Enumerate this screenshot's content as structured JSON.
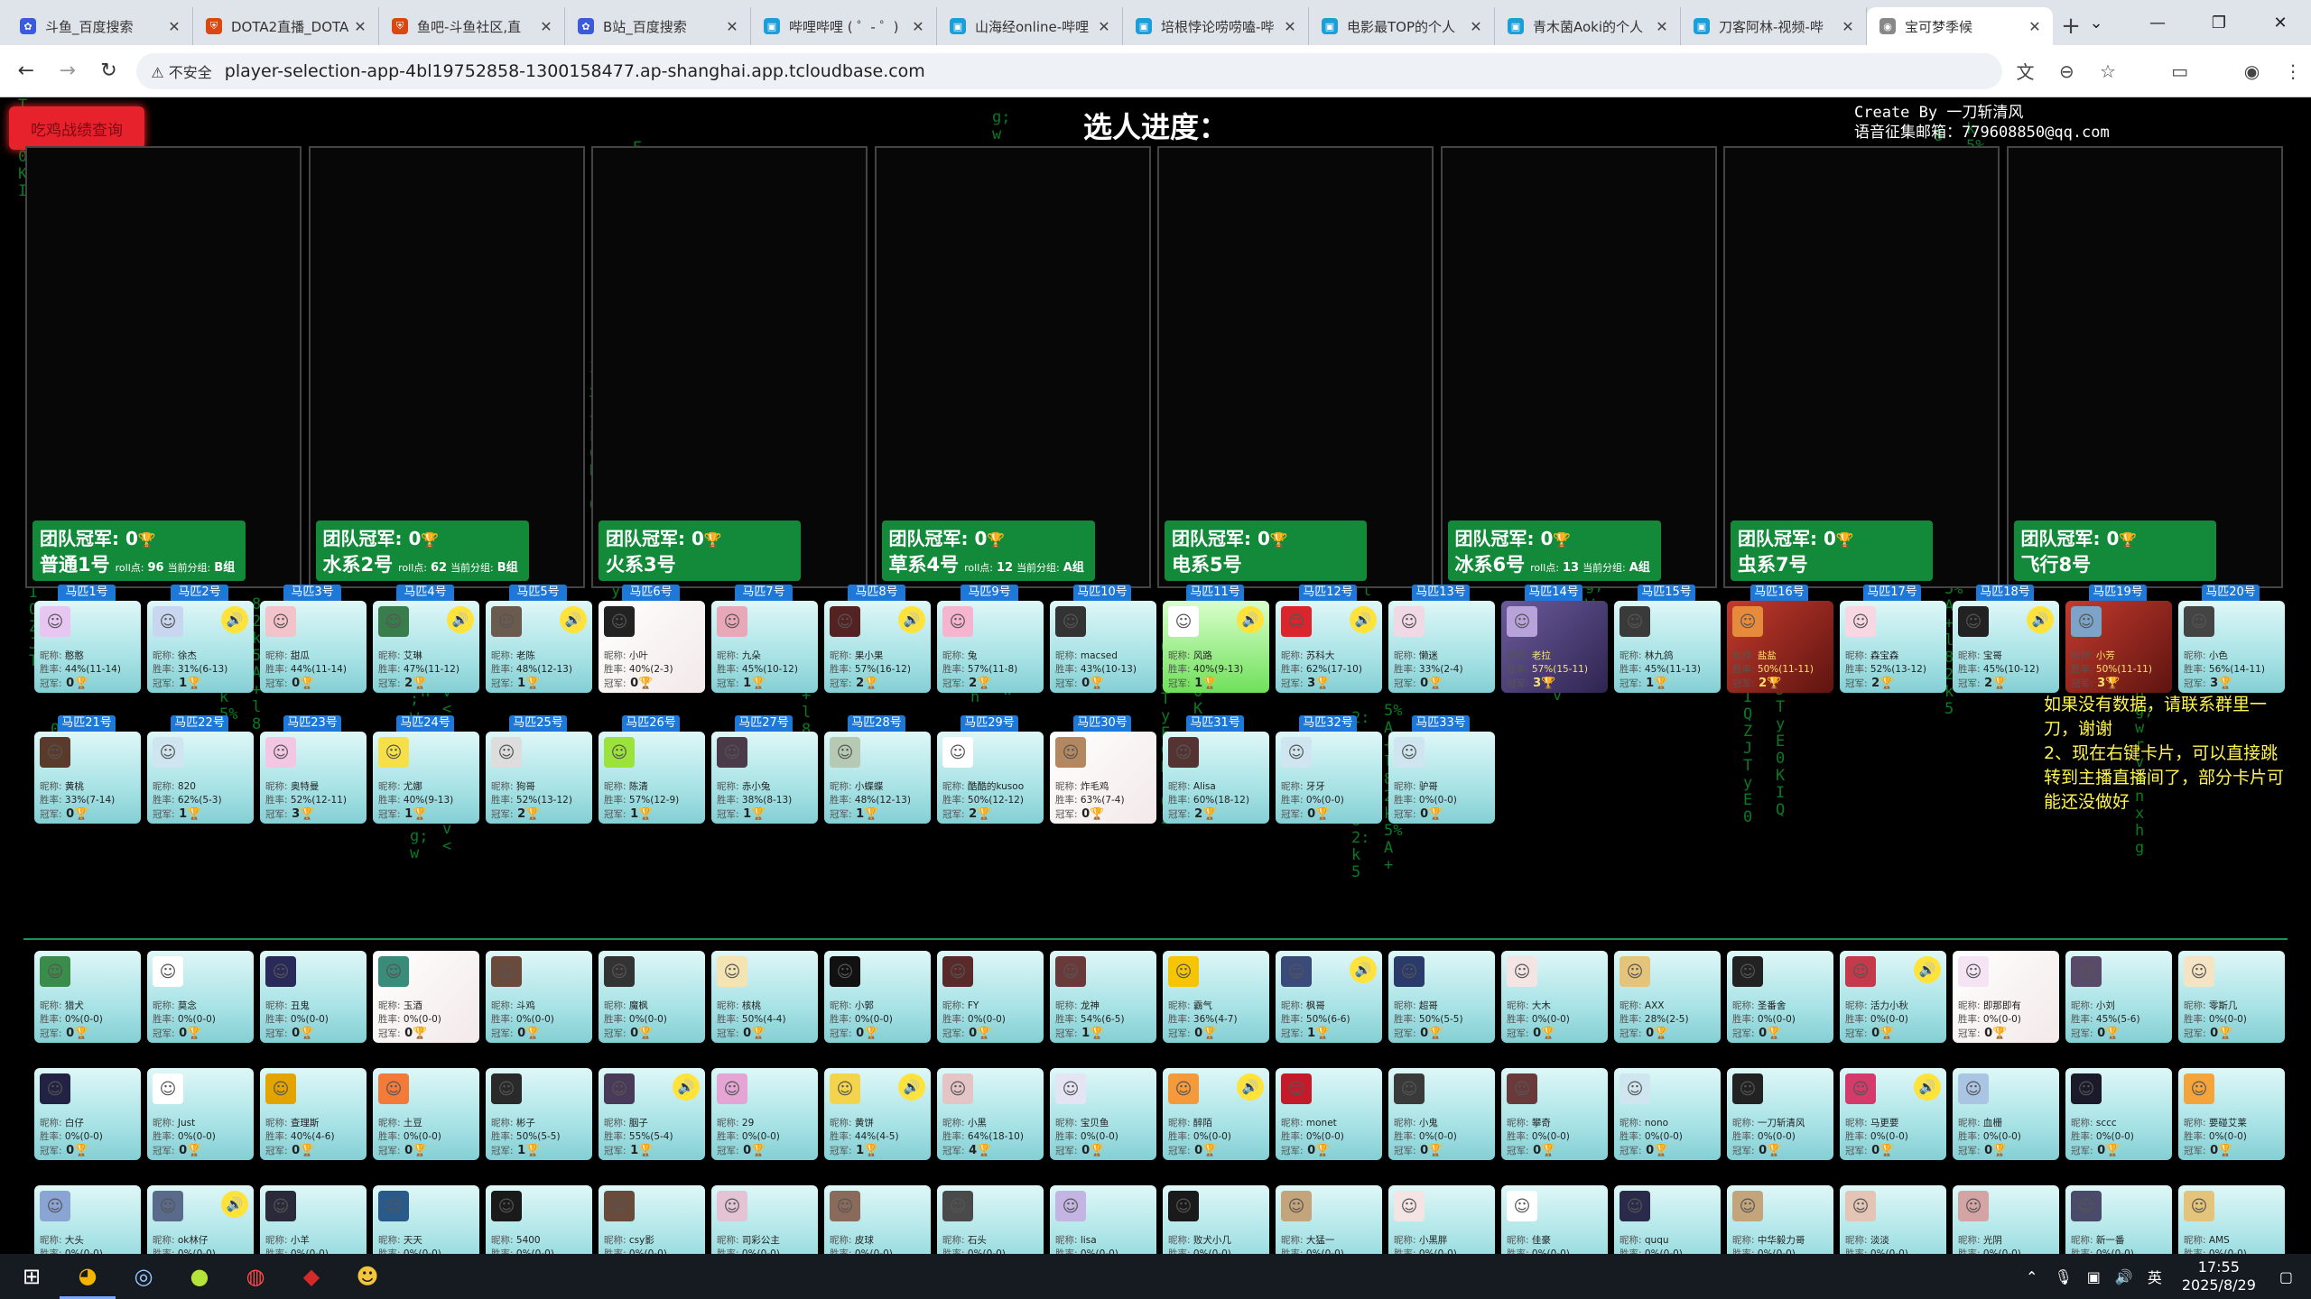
{
  "browser": {
    "tabs": [
      {
        "label": "斗鱼_百度搜索",
        "icon": "paw-icon",
        "color": "#3b5bdb"
      },
      {
        "label": "DOTA2直播_DOTA",
        "icon": "shield-icon",
        "color": "#d9480f"
      },
      {
        "label": "鱼吧-斗鱼社区,直",
        "icon": "shield-icon",
        "color": "#d9480f"
      },
      {
        "label": "B站_百度搜索",
        "icon": "paw-icon",
        "color": "#3b5bdb"
      },
      {
        "label": "哔哩哔哩 ( ゜- ゜)",
        "icon": "tv-icon",
        "color": "#1c9fd8"
      },
      {
        "label": "山海经online-哔哩",
        "icon": "tv-icon",
        "color": "#1c9fd8"
      },
      {
        "label": "培根悖论唠唠嗑-哔",
        "icon": "tv-icon",
        "color": "#1c9fd8"
      },
      {
        "label": "电影最TOP的个人",
        "icon": "tv-icon",
        "color": "#1c9fd8"
      },
      {
        "label": "青木菌Aoki的个人",
        "icon": "tv-icon",
        "color": "#1c9fd8"
      },
      {
        "label": "刀客阿林-视频-哔",
        "icon": "tv-icon",
        "color": "#1c9fd8"
      },
      {
        "label": "宝可梦季候",
        "icon": "globe-icon",
        "color": "#888888",
        "active": true
      }
    ],
    "not_secure": "不安全",
    "url": "player-selection-app-4bl19752858-1300158477.ap-shanghai.app.tcloudbase.com"
  },
  "page": {
    "history_button": "吃鸡战绩查询",
    "progress_title": "选人进度：",
    "creator_line1": "Create By 一刀斩清风",
    "creator_line2": "语音征集邮箱：779608850@qq.com",
    "notice": "如果没有数据，请联系群里一刀，谢谢\n2、现在右键卡片，可以直接跳转到主播直播间了，部分卡片可能还没做好"
  },
  "teams": [
    {
      "champ_label": "团队冠军:",
      "champ_count": "0",
      "name": "普通1号",
      "roll_label": "roll点:",
      "roll": "96",
      "group_label": "当前分组:",
      "group": "B组"
    },
    {
      "champ_label": "团队冠军:",
      "champ_count": "0",
      "name": "水系2号",
      "roll_label": "roll点:",
      "roll": "62",
      "group_label": "当前分组:",
      "group": "B组"
    },
    {
      "champ_label": "团队冠军:",
      "champ_count": "0",
      "name": "火系3号",
      "roll_label": "",
      "roll": "",
      "group_label": "",
      "group": ""
    },
    {
      "champ_label": "团队冠军:",
      "champ_count": "0",
      "name": "草系4号",
      "roll_label": "roll点:",
      "roll": "12",
      "group_label": "当前分组:",
      "group": "A组"
    },
    {
      "champ_label": "团队冠军:",
      "champ_count": "0",
      "name": "电系5号",
      "roll_label": "",
      "roll": "",
      "group_label": "",
      "group": ""
    },
    {
      "champ_label": "团队冠军:",
      "champ_count": "0",
      "name": "冰系6号",
      "roll_label": "roll点:",
      "roll": "13",
      "group_label": "当前分组:",
      "group": "A组"
    },
    {
      "champ_label": "团队冠军:",
      "champ_count": "0",
      "name": "虫系7号",
      "roll_label": "",
      "roll": "",
      "group_label": "",
      "group": ""
    },
    {
      "champ_label": "团队冠军:",
      "champ_count": "0",
      "name": "飞行8号",
      "roll_label": "",
      "roll": "",
      "group_label": "",
      "group": ""
    }
  ],
  "labels": {
    "nick": "昵称:",
    "rate": "胜率:",
    "champ": "冠军:",
    "header_suffix": "号",
    "header_prefix": "马匹"
  },
  "horses": [
    {
      "no": "马匹1号",
      "nick": "憨憨",
      "rate": "44%(11-14)",
      "champ": "0",
      "voice": false,
      "color": "#e7c7f2"
    },
    {
      "no": "马匹2号",
      "nick": "徐杰",
      "rate": "31%(6-13)",
      "champ": "1",
      "voice": true,
      "color": "#c9d6ef"
    },
    {
      "no": "马匹3号",
      "nick": "甜瓜",
      "rate": "44%(11-14)",
      "champ": "0",
      "voice": false,
      "color": "#f2c3c9"
    },
    {
      "no": "马匹4号",
      "nick": "艾琳",
      "rate": "47%(11-12)",
      "champ": "2",
      "voice": true,
      "color": "#3a7d4c"
    },
    {
      "no": "马匹5号",
      "nick": "老陈",
      "rate": "48%(12-13)",
      "champ": "1",
      "voice": true,
      "color": "#6b5a4e"
    },
    {
      "no": "马匹6号",
      "nick": "小叶",
      "rate": "40%(2-3)",
      "champ": "0",
      "voice": false,
      "color": "#222222",
      "style": "img"
    },
    {
      "no": "马匹7号",
      "nick": "九朵",
      "rate": "45%(10-12)",
      "champ": "1",
      "voice": false,
      "color": "#e8a8b8"
    },
    {
      "no": "马匹8号",
      "nick": "果小果",
      "rate": "57%(16-12)",
      "champ": "2",
      "voice": true,
      "color": "#552222"
    },
    {
      "no": "马匹9号",
      "nick": "兔",
      "rate": "57%(11-8)",
      "champ": "2",
      "voice": false,
      "color": "#f5b5cf"
    },
    {
      "no": "马匹10号",
      "nick": "macsed",
      "rate": "43%(10-13)",
      "champ": "0",
      "voice": false,
      "color": "#333333"
    },
    {
      "no": "马匹11号",
      "nick": "风路",
      "rate": "40%(9-13)",
      "champ": "1",
      "voice": true,
      "color": "#ffffff",
      "style": "green"
    },
    {
      "no": "马匹12号",
      "nick": "苏科大",
      "rate": "62%(17-10)",
      "champ": "3",
      "voice": true,
      "color": "#d9252b"
    },
    {
      "no": "马匹13号",
      "nick": "懒迷",
      "rate": "33%(2-4)",
      "champ": "0",
      "voice": false,
      "color": "#f0d8e4"
    },
    {
      "no": "马匹14号",
      "nick": "老拉",
      "rate": "57%(15-11)",
      "champ": "3",
      "voice": false,
      "color": "#b7a2d9",
      "style": "dark"
    },
    {
      "no": "马匹15号",
      "nick": "林九鸽",
      "rate": "45%(11-13)",
      "champ": "1",
      "voice": false,
      "color": "#3a3a3a"
    },
    {
      "no": "马匹16号",
      "nick": "盐盐",
      "rate": "50%(11-11)",
      "champ": "2",
      "voice": false,
      "color": "#e68b3b",
      "style": "red"
    },
    {
      "no": "马匹17号",
      "nick": "森宝森",
      "rate": "52%(13-12)",
      "champ": "2",
      "voice": false,
      "color": "#f7d7e2"
    },
    {
      "no": "马匹18号",
      "nick": "宝哥",
      "rate": "45%(10-12)",
      "champ": "2",
      "voice": true,
      "color": "#222222"
    },
    {
      "no": "马匹19号",
      "nick": "小芳",
      "rate": "50%(11-11)",
      "champ": "3",
      "voice": false,
      "color": "#7da3c8",
      "style": "red"
    },
    {
      "no": "马匹20号",
      "nick": "小色",
      "rate": "56%(14-11)",
      "champ": "3",
      "voice": false,
      "color": "#444444"
    },
    {
      "no": "马匹21号",
      "nick": "黄桃",
      "rate": "33%(7-14)",
      "champ": "0",
      "voice": false,
      "color": "#5a3a2a"
    },
    {
      "no": "马匹22号",
      "nick": "820",
      "rate": "62%(5-3)",
      "champ": "1",
      "voice": false,
      "color": "#cfe6f0"
    },
    {
      "no": "马匹23号",
      "nick": "奥特曼",
      "rate": "52%(12-11)",
      "champ": "3",
      "voice": false,
      "color": "#f3c7e3"
    },
    {
      "no": "马匹24号",
      "nick": "尤娜",
      "rate": "40%(9-13)",
      "champ": "1",
      "voice": false,
      "color": "#f6e04a"
    },
    {
      "no": "马匹25号",
      "nick": "狗哥",
      "rate": "52%(13-12)",
      "champ": "2",
      "voice": false,
      "color": "#dddddd"
    },
    {
      "no": "马匹26号",
      "nick": "陈清",
      "rate": "57%(12-9)",
      "champ": "1",
      "voice": false,
      "color": "#9be23a"
    },
    {
      "no": "马匹27号",
      "nick": "赤小兔",
      "rate": "38%(8-13)",
      "champ": "1",
      "voice": false,
      "color": "#4a3a4a"
    },
    {
      "no": "马匹28号",
      "nick": "小蝶蝶",
      "rate": "48%(12-13)",
      "champ": "1",
      "voice": false,
      "color": "#b6c9b3"
    },
    {
      "no": "马匹29号",
      "nick": "酷酷的kusoo",
      "rate": "50%(12-12)",
      "champ": "2",
      "voice": false,
      "color": "#ffffff"
    },
    {
      "no": "马匹30号",
      "nick": "炸毛鸡",
      "rate": "63%(7-4)",
      "champ": "0",
      "voice": false,
      "color": "#b3875f",
      "style": "img"
    },
    {
      "no": "马匹31号",
      "nick": "Alisa",
      "rate": "60%(18-12)",
      "champ": "2",
      "voice": false,
      "color": "#553333"
    },
    {
      "no": "马匹32号",
      "nick": "牙牙",
      "rate": "0%(0-0)",
      "champ": "0",
      "voice": false,
      "color": "#cfe6f0"
    },
    {
      "no": "马匹33号",
      "nick": "驴哥",
      "rate": "0%(0-0)",
      "champ": "0",
      "voice": false,
      "color": "#cfe6f0"
    }
  ],
  "pool": [
    {
      "nick": "猎犬",
      "rate": "0%(0-0)",
      "champ": "0",
      "voice": false,
      "color": "#3a8c4a"
    },
    {
      "nick": "莫念",
      "rate": "0%(0-0)",
      "champ": "0",
      "voice": false,
      "color": "#ffffff"
    },
    {
      "nick": "丑鬼",
      "rate": "0%(0-0)",
      "champ": "0",
      "voice": false,
      "color": "#2a2a5a"
    },
    {
      "nick": "玉酒",
      "rate": "0%(0-0)",
      "champ": "0",
      "voice": false,
      "color": "#3a8c7a",
      "style": "img"
    },
    {
      "nick": "斗鸡",
      "rate": "0%(0-0)",
      "champ": "0",
      "voice": false,
      "color": "#6a4a3a"
    },
    {
      "nick": "魔枫",
      "rate": "0%(0-0)",
      "champ": "0",
      "voice": false,
      "color": "#333333"
    },
    {
      "nick": "核桃",
      "rate": "50%(4-4)",
      "champ": "0",
      "voice": false,
      "color": "#f4e4b4"
    },
    {
      "nick": "小郭",
      "rate": "0%(0-0)",
      "champ": "0",
      "voice": false,
      "color": "#111111"
    },
    {
      "nick": "FY",
      "rate": "0%(0-0)",
      "champ": "0",
      "voice": false,
      "color": "#5a2a2a"
    },
    {
      "nick": "龙神",
      "rate": "54%(6-5)",
      "champ": "1",
      "voice": false,
      "color": "#6a3a3a"
    },
    {
      "nick": "霸气",
      "rate": "36%(4-7)",
      "champ": "0",
      "voice": false,
      "color": "#f6c400"
    },
    {
      "nick": "枫哥",
      "rate": "50%(6-6)",
      "champ": "1",
      "voice": true,
      "color": "#3a4a7a"
    },
    {
      "nick": "超哥",
      "rate": "50%(5-5)",
      "champ": "0",
      "voice": false,
      "color": "#2a3a6a"
    },
    {
      "nick": "大木",
      "rate": "0%(0-0)",
      "champ": "0",
      "voice": false,
      "color": "#f4e4e4"
    },
    {
      "nick": "AXX",
      "rate": "28%(2-5)",
      "champ": "0",
      "voice": false,
      "color": "#e4c47a"
    },
    {
      "nick": "圣番舍",
      "rate": "0%(0-0)",
      "champ": "0",
      "voice": false,
      "color": "#222222"
    },
    {
      "nick": "活力小秋",
      "rate": "0%(0-0)",
      "champ": "0",
      "voice": true,
      "color": "#c43a4a"
    },
    {
      "nick": "即那即有",
      "rate": "0%(0-0)",
      "champ": "0",
      "voice": false,
      "color": "#f4e4f4",
      "style": "img"
    },
    {
      "nick": "小刘",
      "rate": "45%(5-6)",
      "champ": "0",
      "voice": false,
      "color": "#5a4a6a"
    },
    {
      "nick": "零斯几",
      "rate": "0%(0-0)",
      "champ": "0",
      "voice": false,
      "color": "#f4e4c4"
    },
    {
      "nick": "白仔",
      "rate": "0%(0-0)",
      "champ": "0",
      "voice": false,
      "color": "#222244"
    },
    {
      "nick": "Just",
      "rate": "0%(0-0)",
      "champ": "0",
      "voice": false,
      "color": "#ffffff"
    },
    {
      "nick": "查理斯",
      "rate": "40%(4-6)",
      "champ": "0",
      "voice": false,
      "color": "#e4a400"
    },
    {
      "nick": "土豆",
      "rate": "0%(0-0)",
      "champ": "0",
      "voice": false,
      "color": "#f47a3a"
    },
    {
      "nick": "彬子",
      "rate": "50%(5-5)",
      "champ": "1",
      "voice": false,
      "color": "#2a2a2a"
    },
    {
      "nick": "胭子",
      "rate": "55%(5-4)",
      "champ": "1",
      "voice": true,
      "color": "#4a3a5a"
    },
    {
      "nick": "29",
      "rate": "0%(0-0)",
      "champ": "0",
      "voice": false,
      "color": "#e4a4d4"
    },
    {
      "nick": "黄饼",
      "rate": "44%(4-5)",
      "champ": "1",
      "voice": true,
      "color": "#f4d44a"
    },
    {
      "nick": "小黑",
      "rate": "64%(18-10)",
      "champ": "4",
      "voice": false,
      "color": "#e4c4c4"
    },
    {
      "nick": "宝贝鱼",
      "rate": "0%(0-0)",
      "champ": "0",
      "voice": false,
      "color": "#e4e4f4"
    },
    {
      "nick": "醉陌",
      "rate": "0%(0-0)",
      "champ": "0",
      "voice": true,
      "color": "#f49a3a"
    },
    {
      "nick": "monet",
      "rate": "0%(0-0)",
      "champ": "0",
      "voice": false,
      "color": "#c41a2a"
    },
    {
      "nick": "小鬼",
      "rate": "0%(0-0)",
      "champ": "0",
      "voice": false,
      "color": "#3a3a3a"
    },
    {
      "nick": "攀奇",
      "rate": "0%(0-0)",
      "champ": "0",
      "voice": false,
      "color": "#6a3a3a"
    },
    {
      "nick": "nono",
      "rate": "0%(0-0)",
      "champ": "0",
      "voice": false,
      "color": "#cfe6f0"
    },
    {
      "nick": "一刀斩清风",
      "rate": "0%(0-0)",
      "champ": "0",
      "voice": false,
      "color": "#222222"
    },
    {
      "nick": "马更要",
      "rate": "0%(0-0)",
      "champ": "0",
      "voice": true,
      "color": "#d43a6a"
    },
    {
      "nick": "血栅",
      "rate": "0%(0-0)",
      "champ": "0",
      "voice": false,
      "color": "#aac4e4"
    },
    {
      "nick": "sccc",
      "rate": "0%(0-0)",
      "champ": "0",
      "voice": false,
      "color": "#1a1a2a"
    },
    {
      "nick": "要碰艾莱",
      "rate": "0%(0-0)",
      "champ": "0",
      "voice": false,
      "color": "#f4a43a"
    },
    {
      "nick": "大头",
      "rate": "0%(0-0)",
      "champ": "0",
      "voice": false,
      "color": "#8aa4d4"
    },
    {
      "nick": "ok林仔",
      "rate": "0%(0-0)",
      "champ": "0",
      "voice": true,
      "color": "#5a6a8a"
    },
    {
      "nick": "小羊",
      "rate": "0%(0-0)",
      "champ": "0",
      "voice": false,
      "color": "#2a2a3a"
    },
    {
      "nick": "天天",
      "rate": "0%(0-0)",
      "champ": "0",
      "voice": false,
      "color": "#2a5a8a"
    },
    {
      "nick": "5400",
      "rate": "0%(0-0)",
      "champ": "0",
      "voice": false,
      "color": "#1a1a1a"
    },
    {
      "nick": "csy影",
      "rate": "0%(0-0)",
      "champ": "0",
      "voice": false,
      "color": "#6a4a3a"
    },
    {
      "nick": "司彩公主",
      "rate": "0%(0-0)",
      "champ": "0",
      "voice": false,
      "color": "#e4c4d4"
    },
    {
      "nick": "皮球",
      "rate": "0%(0-0)",
      "champ": "0",
      "voice": false,
      "color": "#8a6a5a"
    },
    {
      "nick": "石头",
      "rate": "0%(0-0)",
      "champ": "0",
      "voice": false,
      "color": "#4a4a4a"
    },
    {
      "nick": "lisa",
      "rate": "0%(0-0)",
      "champ": "0",
      "voice": false,
      "color": "#c4b4e4"
    },
    {
      "nick": "败犬小几",
      "rate": "0%(0-0)",
      "champ": "0",
      "voice": false,
      "color": "#1a1a1a"
    },
    {
      "nick": "大猛一",
      "rate": "0%(0-0)",
      "champ": "0",
      "voice": false,
      "color": "#c4a47a"
    },
    {
      "nick": "小黑胖",
      "rate": "0%(0-0)",
      "champ": "0",
      "voice": false,
      "color": "#f4e4e4"
    },
    {
      "nick": "佳豪",
      "rate": "0%(0-0)",
      "champ": "0",
      "voice": false,
      "color": "#ffffff"
    },
    {
      "nick": "ququ",
      "rate": "0%(0-0)",
      "champ": "0",
      "voice": false,
      "color": "#2a2a4a"
    },
    {
      "nick": "中华毅力哥",
      "rate": "0%(0-0)",
      "champ": "0",
      "voice": false,
      "color": "#c4a47a"
    },
    {
      "nick": "淡淡",
      "rate": "0%(0-0)",
      "champ": "0",
      "voice": false,
      "color": "#e4c4b4"
    },
    {
      "nick": "光阴",
      "rate": "0%(0-0)",
      "champ": "0",
      "voice": false,
      "color": "#d4a4a4"
    },
    {
      "nick": "新一番",
      "rate": "0%(0-0)",
      "champ": "0",
      "voice": false,
      "color": "#4a4a6a"
    },
    {
      "nick": "AMS",
      "rate": "0%(0-0)",
      "champ": "0",
      "voice": false,
      "color": "#e4c47a"
    }
  ],
  "taskbar": {
    "time": "17:55",
    "date": "2025/8/29",
    "ime": "英"
  }
}
